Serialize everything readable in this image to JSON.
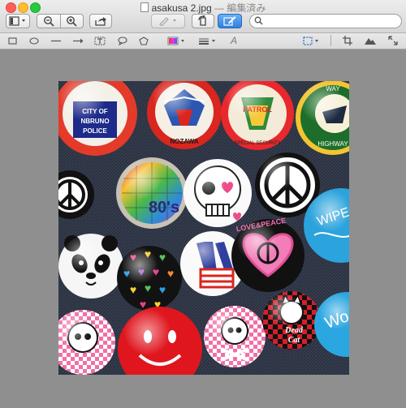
{
  "window": {
    "title": "asakusa 2.jpg",
    "separator": "—",
    "edited_label": "編集済み"
  },
  "toolbar": {
    "search": {
      "placeholder": "",
      "value": ""
    },
    "buttons": [
      "sidebar-toggle",
      "zoom-out",
      "zoom-in",
      "share",
      "annotate",
      "rotate",
      "markup-toolbar"
    ]
  },
  "markup_tools": [
    "rectangle-selection",
    "oval-selection",
    "line",
    "arrow",
    "text-box",
    "speech-bubble",
    "shape",
    "color",
    "line-style",
    "text-style",
    "adjust-size",
    "crop",
    "adjust-color",
    "fullscreen"
  ],
  "image": {
    "description_colors": {
      "background": "#2d3340",
      "accent_red": "#d8202a",
      "accent_blue": "#2ba3dc"
    },
    "badges": [
      {
        "text": "CITY OF\nNBRUNO\nPOLICE"
      },
      {
        "text": "NOZAWA"
      },
      {
        "text": "PATROL\nSPECIAL SECURITY"
      },
      {
        "text": "WAY\nHIGHWAY"
      },
      {
        "text": "80's"
      },
      {
        "text": "LOVE&PEACE"
      },
      {
        "text": "Dead\nCat"
      },
      {
        "text": "WIPE"
      },
      {
        "text": "Wo"
      }
    ]
  }
}
